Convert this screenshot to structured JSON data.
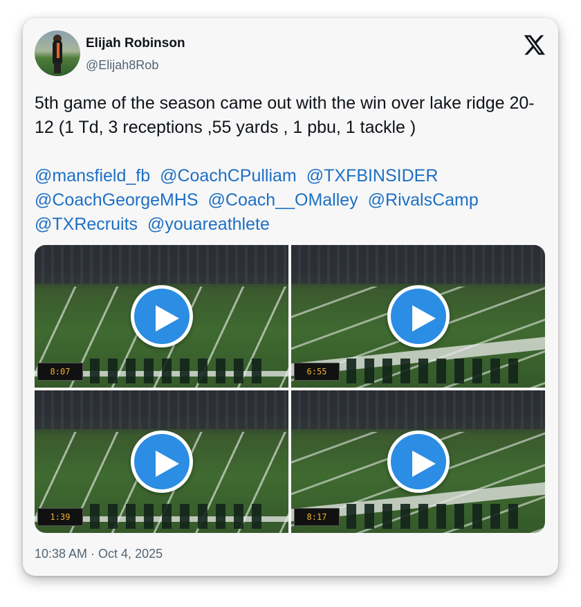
{
  "author": {
    "name": "Elijah Robinson",
    "handle": "@Elijah8Rob"
  },
  "tweet": {
    "text": "5th game of the season came out with the win over lake ridge 20-12 (1 Td, 3 receptions ,55 yards , 1 pbu, 1 tackle )",
    "mentions": [
      "@mansfield_fb",
      "@CoachCPulliam",
      "@TXFBINSIDER",
      "@CoachGeorgeMHS",
      "@Coach__OMalley",
      "@RivalsCamp",
      "@TXRecruits",
      "@youareathlete"
    ],
    "timestamp": "10:38 AM · Oct 4, 2025"
  },
  "media": {
    "videos": [
      {
        "scoreboard_clock": "8:07"
      },
      {
        "scoreboard_clock": "6:55"
      },
      {
        "scoreboard_clock": "1:39"
      },
      {
        "scoreboard_clock": "8:17"
      }
    ]
  },
  "icons": {
    "brand": "x-logo-icon",
    "play": "play-icon"
  },
  "colors": {
    "link": "#1d6fc4",
    "play_button": "#2b8de3",
    "text": "#0f1419",
    "secondary_text": "#536471"
  }
}
